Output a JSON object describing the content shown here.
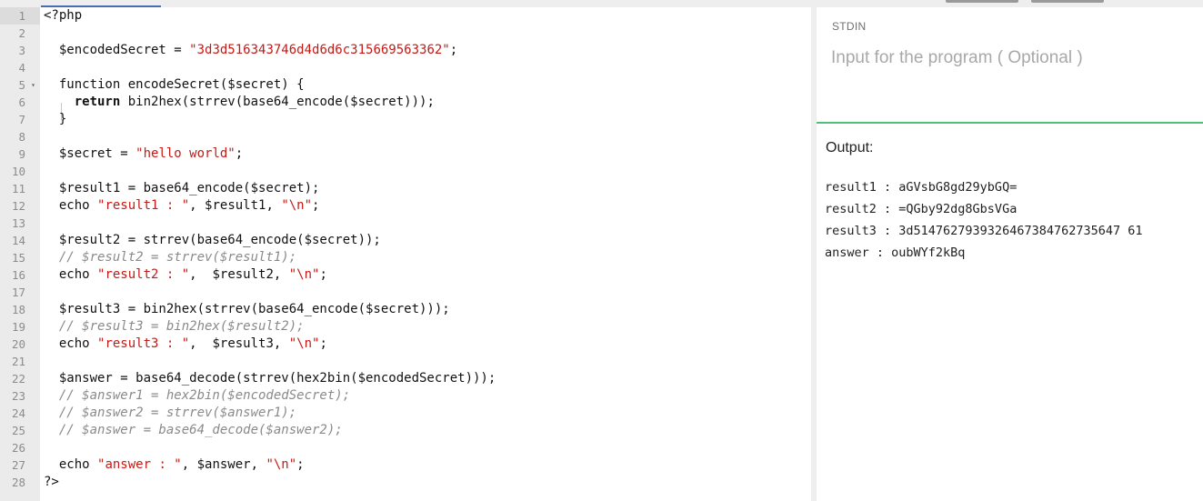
{
  "editor": {
    "line_numbers": [
      "1",
      "2",
      "3",
      "4",
      "5",
      "6",
      "7",
      "8",
      "9",
      "10",
      "11",
      "12",
      "13",
      "14",
      "15",
      "16",
      "17",
      "18",
      "19",
      "20",
      "21",
      "22",
      "23",
      "24",
      "25",
      "26",
      "27",
      "28"
    ],
    "fold_marker": "▾",
    "lines": [
      [
        {
          "t": "plain",
          "v": "<?php"
        }
      ],
      [],
      [
        {
          "t": "plain",
          "v": "  $encodedSecret = "
        },
        {
          "t": "str",
          "v": "\"3d3d516343746d4d6d6c315669563362\""
        },
        {
          "t": "plain",
          "v": ";"
        }
      ],
      [],
      [
        {
          "t": "plain",
          "v": "  function encodeSecret($secret) {"
        }
      ],
      [
        {
          "t": "plain",
          "v": "    "
        },
        {
          "t": "kw",
          "v": "return"
        },
        {
          "t": "plain",
          "v": " bin2hex(strrev(base64_encode($secret)));"
        }
      ],
      [
        {
          "t": "plain",
          "v": "  }"
        }
      ],
      [],
      [
        {
          "t": "plain",
          "v": "  $secret = "
        },
        {
          "t": "str",
          "v": "\"hello world\""
        },
        {
          "t": "plain",
          "v": ";"
        }
      ],
      [],
      [
        {
          "t": "plain",
          "v": "  $result1 = base64_encode($secret);"
        }
      ],
      [
        {
          "t": "plain",
          "v": "  echo "
        },
        {
          "t": "str",
          "v": "\"result1 : \""
        },
        {
          "t": "plain",
          "v": ", $result1, "
        },
        {
          "t": "str",
          "v": "\"\\n\""
        },
        {
          "t": "plain",
          "v": ";"
        }
      ],
      [],
      [
        {
          "t": "plain",
          "v": "  $result2 = strrev(base64_encode($secret));"
        }
      ],
      [
        {
          "t": "plain",
          "v": "  "
        },
        {
          "t": "com",
          "v": "// $result2 = strrev($result1);"
        }
      ],
      [
        {
          "t": "plain",
          "v": "  echo "
        },
        {
          "t": "str",
          "v": "\"result2 : \""
        },
        {
          "t": "plain",
          "v": ",  $result2, "
        },
        {
          "t": "str",
          "v": "\"\\n\""
        },
        {
          "t": "plain",
          "v": ";"
        }
      ],
      [],
      [
        {
          "t": "plain",
          "v": "  $result3 = bin2hex(strrev(base64_encode($secret)));"
        }
      ],
      [
        {
          "t": "plain",
          "v": "  "
        },
        {
          "t": "com",
          "v": "// $result3 = bin2hex($result2);"
        }
      ],
      [
        {
          "t": "plain",
          "v": "  echo "
        },
        {
          "t": "str",
          "v": "\"result3 : \""
        },
        {
          "t": "plain",
          "v": ",  $result3, "
        },
        {
          "t": "str",
          "v": "\"\\n\""
        },
        {
          "t": "plain",
          "v": ";"
        }
      ],
      [],
      [
        {
          "t": "plain",
          "v": "  $answer = base64_decode(strrev(hex2bin($encodedSecret)));"
        }
      ],
      [
        {
          "t": "plain",
          "v": "  "
        },
        {
          "t": "com",
          "v": "// $answer1 = hex2bin($encodedSecret);"
        }
      ],
      [
        {
          "t": "plain",
          "v": "  "
        },
        {
          "t": "com",
          "v": "// $answer2 = strrev($answer1);"
        }
      ],
      [
        {
          "t": "plain",
          "v": "  "
        },
        {
          "t": "com",
          "v": "// $answer = base64_decode($answer2);"
        }
      ],
      [],
      [
        {
          "t": "plain",
          "v": "  echo "
        },
        {
          "t": "str",
          "v": "\"answer : \""
        },
        {
          "t": "plain",
          "v": ", $answer, "
        },
        {
          "t": "str",
          "v": "\"\\n\""
        },
        {
          "t": "plain",
          "v": ";"
        }
      ],
      [
        {
          "t": "plain",
          "v": "?>"
        }
      ]
    ]
  },
  "stdin": {
    "label": "STDIN",
    "placeholder": "Input for the program ( Optional )",
    "value": ""
  },
  "output": {
    "label": "Output:",
    "lines": [
      "result1 : aGVsbG8gd29ybGQ=",
      "result2 : =QGby92dg8GbsVGa",
      "result3 : 3d5147627939326467384762735647 61",
      "answer : oubWYf2kBq"
    ]
  },
  "colors": {
    "string": "#c41a16",
    "comment": "#8a8a8a",
    "output_divider": "#4ec07a",
    "active_tab_indicator": "#4a6bb5"
  }
}
